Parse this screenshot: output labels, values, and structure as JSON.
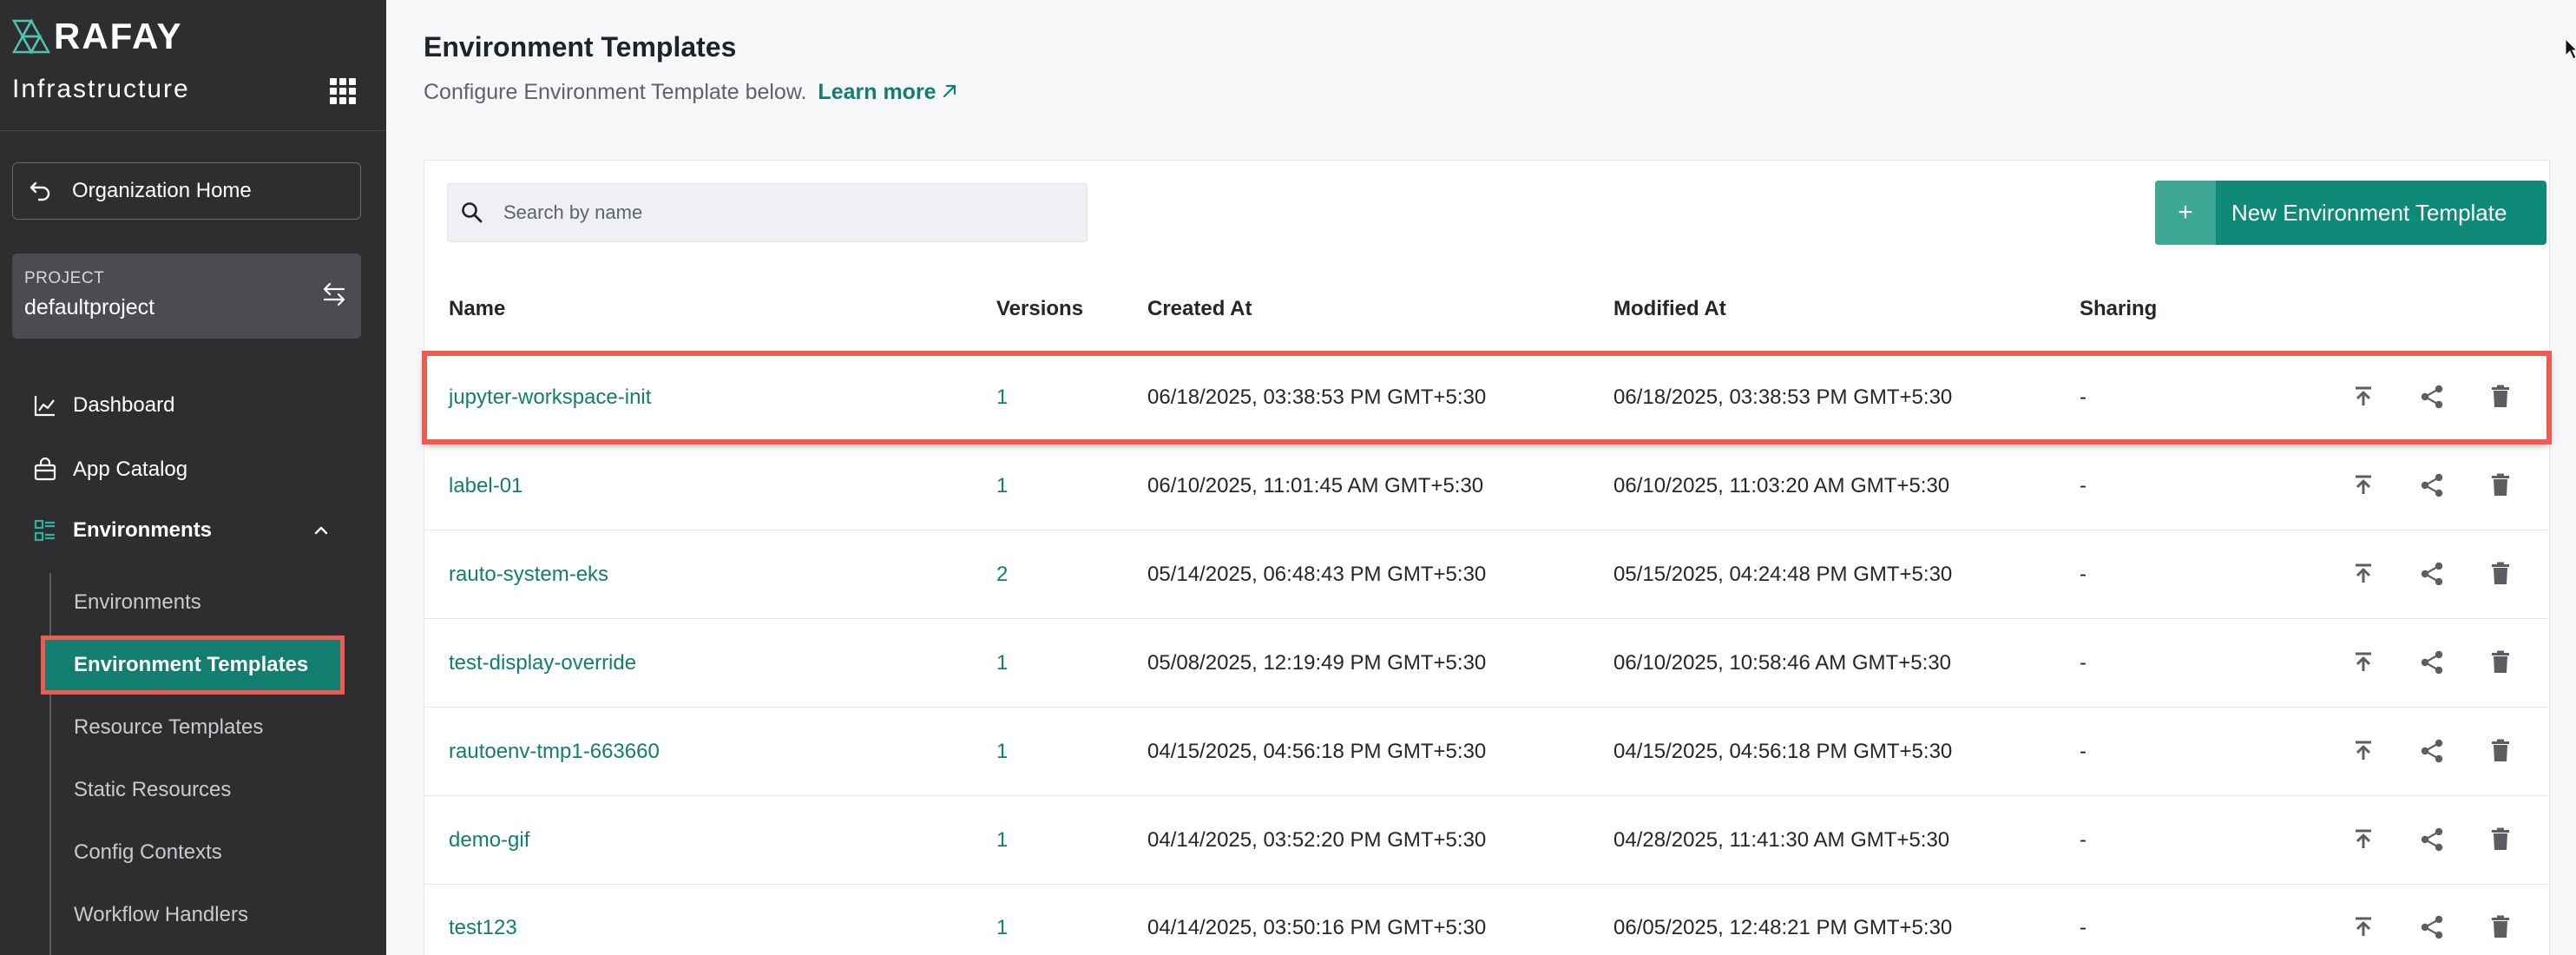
{
  "sidebar": {
    "logo_text": "RAFAY",
    "section_title": "Infrastructure",
    "org_home": "Organization Home",
    "project_label": "PROJECT",
    "project_value": "defaultproject",
    "nav": {
      "dashboard": "Dashboard",
      "app_catalog": "App Catalog",
      "environments": "Environments"
    },
    "sub": {
      "environments": "Environments",
      "environment_templates": "Environment Templates",
      "resource_templates": "Resource Templates",
      "static_resources": "Static Resources",
      "config_contexts": "Config Contexts",
      "workflow_handlers": "Workflow Handlers"
    }
  },
  "header": {
    "title": "Environment Templates",
    "subtitle": "Configure Environment Template below.",
    "learn_more": "Learn more"
  },
  "toolbar": {
    "search_placeholder": "Search by name",
    "new_button": "New Environment Template",
    "new_button_icon": "+"
  },
  "table": {
    "headers": {
      "name": "Name",
      "versions": "Versions",
      "created": "Created At",
      "modified": "Modified At",
      "sharing": "Sharing"
    },
    "rows": [
      {
        "name": "jupyter-workspace-init",
        "versions": "1",
        "created": "06/18/2025, 03:38:53 PM GMT+5:30",
        "modified": "06/18/2025, 03:38:53 PM GMT+5:30",
        "sharing": "-"
      },
      {
        "name": "label-01",
        "versions": "1",
        "created": "06/10/2025, 11:01:45 AM GMT+5:30",
        "modified": "06/10/2025, 11:03:20 AM GMT+5:30",
        "sharing": "-"
      },
      {
        "name": "rauto-system-eks",
        "versions": "2",
        "created": "05/14/2025, 06:48:43 PM GMT+5:30",
        "modified": "05/15/2025, 04:24:48 PM GMT+5:30",
        "sharing": "-"
      },
      {
        "name": "test-display-override",
        "versions": "1",
        "created": "05/08/2025, 12:19:49 PM GMT+5:30",
        "modified": "06/10/2025, 10:58:46 AM GMT+5:30",
        "sharing": "-"
      },
      {
        "name": "rautoenv-tmp1-663660",
        "versions": "1",
        "created": "04/15/2025, 04:56:18 PM GMT+5:30",
        "modified": "04/15/2025, 04:56:18 PM GMT+5:30",
        "sharing": "-"
      },
      {
        "name": "demo-gif",
        "versions": "1",
        "created": "04/14/2025, 03:52:20 PM GMT+5:30",
        "modified": "04/28/2025, 11:41:30 AM GMT+5:30",
        "sharing": "-"
      },
      {
        "name": "test123",
        "versions": "1",
        "created": "04/14/2025, 03:50:16 PM GMT+5:30",
        "modified": "06/05/2025, 12:48:21 PM GMT+5:30",
        "sharing": "-"
      }
    ]
  },
  "colors": {
    "accent": "#137d6f",
    "sidebar_bg": "#2e2e30",
    "highlight": "#ef5b50"
  },
  "icons": [
    "logo-icon",
    "app-grid-icon",
    "back-arrow-icon",
    "swap-icon",
    "dashboard-chart-icon",
    "catalog-bag-icon",
    "environments-list-icon",
    "chevron-up-icon",
    "external-link-icon",
    "search-icon",
    "publish-icon",
    "share-icon",
    "trash-icon"
  ]
}
